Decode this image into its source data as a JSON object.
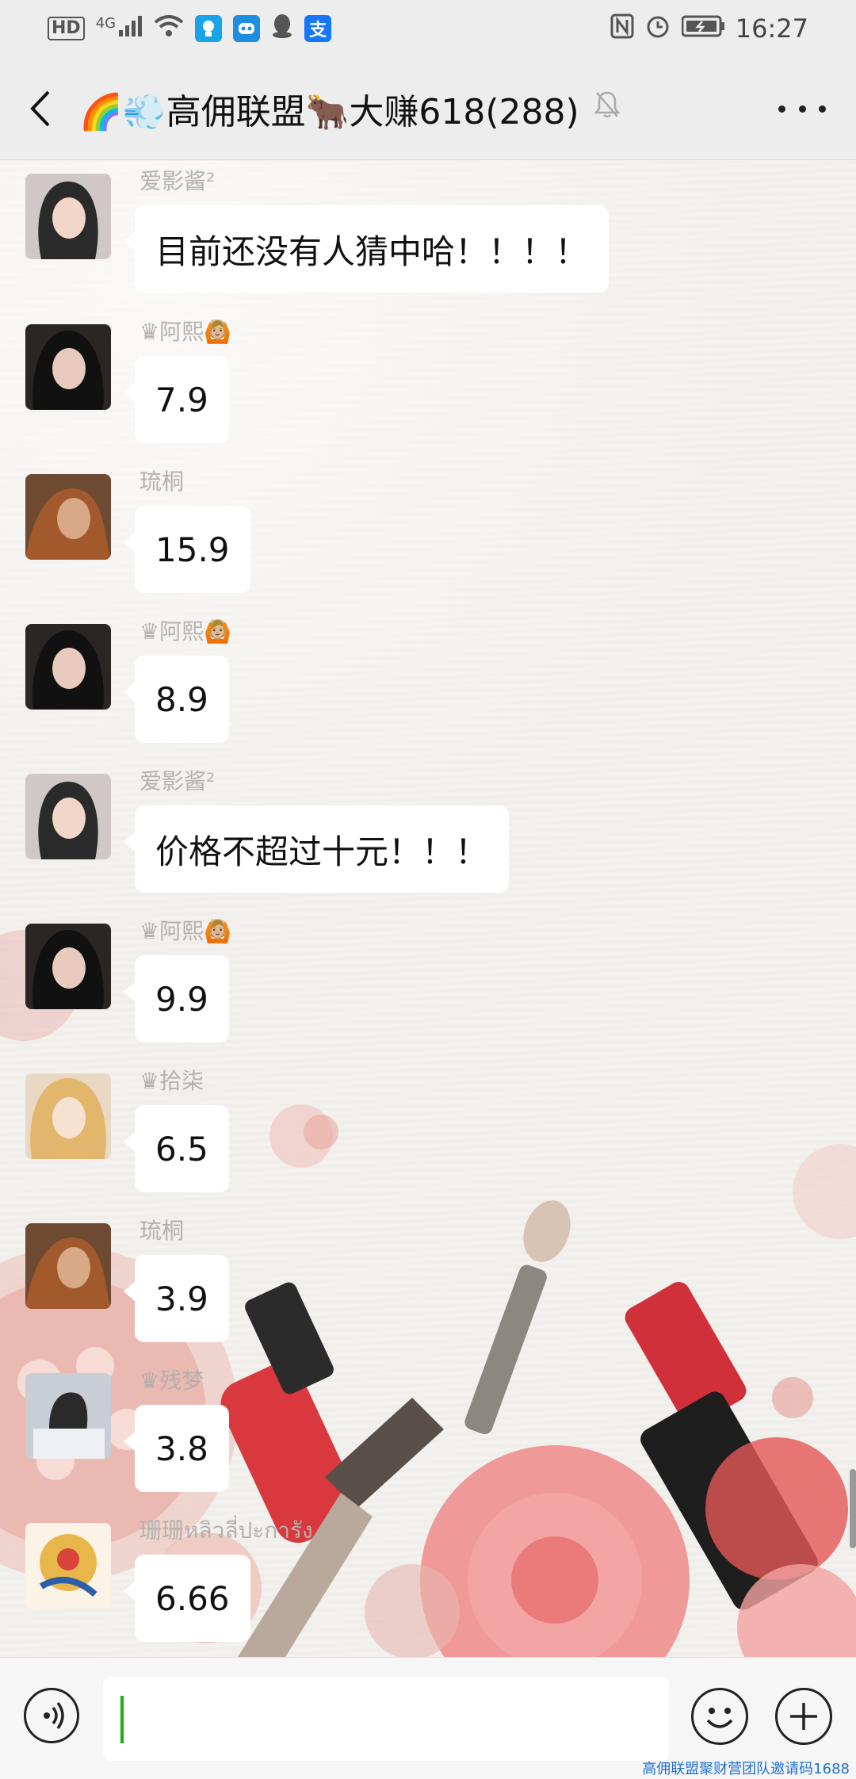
{
  "status_bar": {
    "network": "HD",
    "signal": "4G",
    "icons": [
      "signal-icon",
      "wifi-icon",
      "bulb-app-icon",
      "robot-app-icon",
      "qq-icon",
      "alipay-icon",
      "nfc-icon",
      "alarm-icon",
      "battery-icon"
    ],
    "alipay_glyph": "支",
    "time": "16:27"
  },
  "header": {
    "title": "🌈💨高佣联盟🐂大赚618(288)",
    "muted": true
  },
  "messages": [
    {
      "sender": "爱影酱²",
      "text": "目前还没有人猜中哈！！！！",
      "avatar_color": "#cfc8c6"
    },
    {
      "sender": "♛阿熙🙆🏼",
      "text": "7.9",
      "avatar_color": "#2a2624"
    },
    {
      "sender": "琉桐",
      "text": "15.9",
      "avatar_color": "#6e4a32"
    },
    {
      "sender": "♛阿熙🙆🏼",
      "text": "8.9",
      "avatar_color": "#2a2624"
    },
    {
      "sender": "爱影酱²",
      "text": "价格不超过十元！！！",
      "avatar_color": "#cfc8c6"
    },
    {
      "sender": "♛阿熙🙆🏼",
      "text": "9.9",
      "avatar_color": "#2a2624"
    },
    {
      "sender": "♛拾柒",
      "text": "6.5",
      "avatar_color": "#e9d8c4"
    },
    {
      "sender": "琉桐",
      "text": "3.9",
      "avatar_color": "#6e4a32"
    },
    {
      "sender": "♛残梦",
      "text": "3.8",
      "avatar_color": "#c9cdd6"
    },
    {
      "sender": "珊珊หลิวลี่ปะการัง",
      "text": "6.66",
      "avatar_color": "#e8b64a"
    }
  ],
  "input": {
    "value": "",
    "placeholder": ""
  },
  "watermark": "高佣联盟聚财营团队邀请码1688",
  "colors": {
    "bar_bg": "#ededed",
    "bubble_bg": "#ffffff",
    "caret": "#1aad19",
    "sender_text": "#b5b0ab"
  }
}
